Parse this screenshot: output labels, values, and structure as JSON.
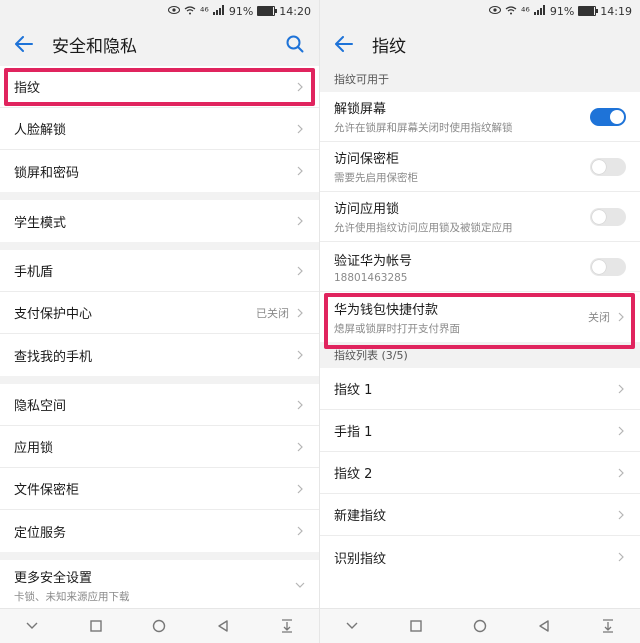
{
  "left": {
    "status": {
      "signal_text": "⁴⁶",
      "battery": "91%",
      "time": "14:20",
      "battery_level": 0.91
    },
    "title": "安全和隐私",
    "groups": [
      [
        {
          "label": "指纹"
        },
        {
          "label": "人脸解锁"
        },
        {
          "label": "锁屏和密码"
        }
      ],
      [
        {
          "label": "学生模式"
        }
      ],
      [
        {
          "label": "手机盾"
        },
        {
          "label": "支付保护中心",
          "value": "已关闭"
        },
        {
          "label": "查找我的手机"
        }
      ],
      [
        {
          "label": "隐私空间"
        },
        {
          "label": "应用锁"
        },
        {
          "label": "文件保密柜"
        },
        {
          "label": "定位服务"
        }
      ]
    ],
    "more": {
      "title": "更多安全设置",
      "subtitle": "卡锁、未知来源应用下载"
    }
  },
  "right": {
    "status": {
      "signal_text": "⁴⁶",
      "battery": "91%",
      "time": "14:19",
      "battery_level": 0.91
    },
    "title": "指纹",
    "section1": "指纹可用于",
    "items": [
      {
        "title": "解锁屏幕",
        "subtitle": "允许在锁屏和屏幕关闭时使用指纹解锁",
        "toggle": "on"
      },
      {
        "title": "访问保密柜",
        "subtitle": "需要先启用保密柜",
        "toggle": "off"
      },
      {
        "title": "访问应用锁",
        "subtitle": "允许使用指纹访问应用锁及被锁定应用",
        "toggle": "off"
      },
      {
        "title": "验证华为帐号",
        "subtitle": "18801463285",
        "toggle": "off"
      }
    ],
    "wallet": {
      "title": "华为钱包快捷付款",
      "subtitle": "熄屏或锁屏时打开支付界面",
      "value": "关闭"
    },
    "section2": "指纹列表 (3/5)",
    "list": [
      {
        "label": "指纹 1"
      },
      {
        "label": "手指 1"
      },
      {
        "label": "指纹 2"
      },
      {
        "label": "新建指纹"
      },
      {
        "label": "识别指纹"
      }
    ]
  },
  "colors": {
    "accent": "#1e73d8",
    "highlight": "#e0245e"
  }
}
